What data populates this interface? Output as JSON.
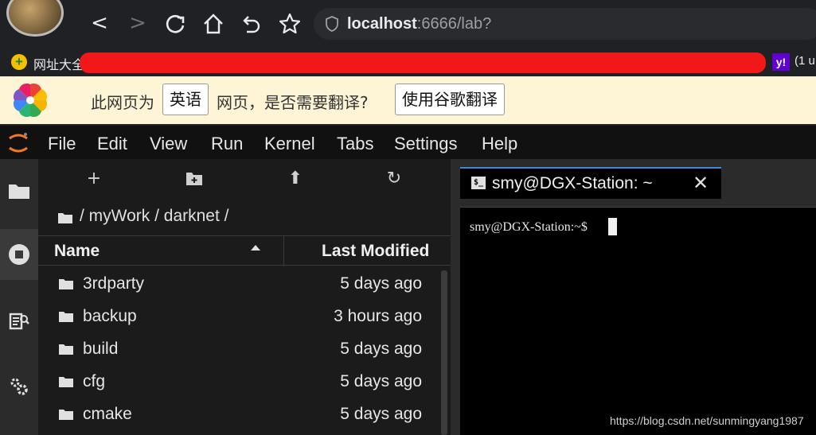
{
  "browser": {
    "back_glyph": "<",
    "forward_glyph": ">",
    "reload_glyph": "C",
    "home_glyph": "⌂",
    "undo_glyph": "↶",
    "star_glyph": "☆",
    "url_host": "localhost",
    "url_rest": ":6666/lab?"
  },
  "bookmarks": {
    "first_label": "网址大全",
    "trailing_label": "(1 u",
    "yahoo_icon_text": "y!"
  },
  "translate": {
    "prefix": "此网页为",
    "language_button": "英语",
    "suffix": "网页，是否需要翻译?",
    "translate_button": "使用谷歌翻译"
  },
  "menubar": {
    "items": [
      "File",
      "Edit",
      "View",
      "Run",
      "Kernel",
      "Tabs",
      "Settings",
      "Help"
    ]
  },
  "file_browser": {
    "toolbar": {
      "new_glyph": "+",
      "upload_glyph": "⬆",
      "refresh_glyph": "↻"
    },
    "breadcrumb": "/ myWork / darknet /",
    "columns": {
      "name": "Name",
      "last_modified": "Last Modified"
    },
    "rows": [
      {
        "name": "3rdparty",
        "modified": "5 days ago"
      },
      {
        "name": "backup",
        "modified": "3 hours ago"
      },
      {
        "name": "build",
        "modified": "5 days ago"
      },
      {
        "name": "cfg",
        "modified": "5 days ago"
      },
      {
        "name": "cmake",
        "modified": "5 days ago"
      }
    ]
  },
  "terminal": {
    "tab_icon_text": "$_",
    "tab_title": "smy@DGX-Station: ~",
    "close_glyph": "✕",
    "prompt": "smy@DGX-Station:~$"
  },
  "watermark": "https://blog.csdn.net/sunmingyang1987",
  "colors": {
    "accent": "#3b8ad9",
    "redaction": "#f01818",
    "translate_bar": "#fdf5d6"
  }
}
